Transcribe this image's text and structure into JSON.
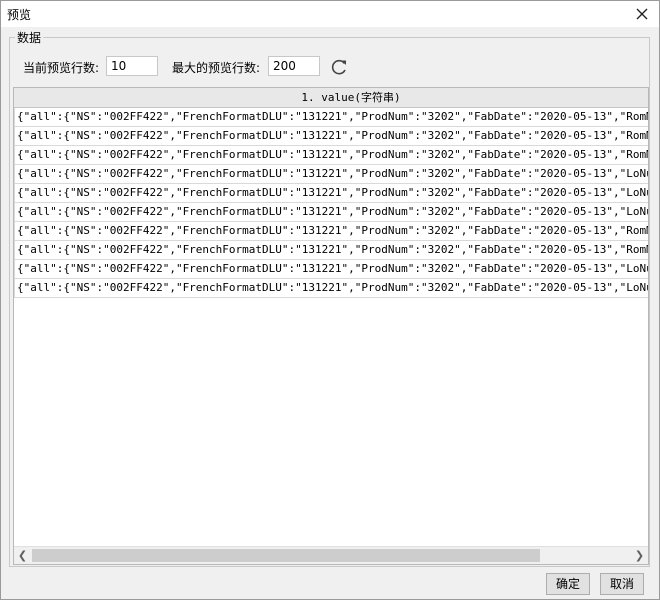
{
  "window": {
    "title": "预览"
  },
  "group": {
    "label": "数据"
  },
  "controls": {
    "current_rows_label": "当前预览行数:",
    "current_rows_value": "10",
    "max_rows_label": "最大的预览行数:",
    "max_rows_value": "200"
  },
  "grid": {
    "header": "1. value(字符串)",
    "rows": [
      "{\"all\":{\"NS\":\"002FF422\",\"FrenchFormatDLU\":\"131221\",\"ProdNum\":\"3202\",\"FabDate\":\"2020-05-13\",\"RomMask\":\"W2\",",
      "{\"all\":{\"NS\":\"002FF422\",\"FrenchFormatDLU\":\"131221\",\"ProdNum\":\"3202\",\"FabDate\":\"2020-05-13\",\"RomMask\":\"W2\",",
      "{\"all\":{\"NS\":\"002FF422\",\"FrenchFormatDLU\":\"131221\",\"ProdNum\":\"3202\",\"FabDate\":\"2020-05-13\",\"RomMask\":\"W2\",",
      "{\"all\":{\"NS\":\"002FF422\",\"FrenchFormatDLU\":\"131221\",\"ProdNum\":\"3202\",\"FabDate\":\"2020-05-13\",\"LoNum\":\"\",\"Ron",
      "{\"all\":{\"NS\":\"002FF422\",\"FrenchFormatDLU\":\"131221\",\"ProdNum\":\"3202\",\"FabDate\":\"2020-05-13\",\"LoNum\":\"\",\"Ron",
      "{\"all\":{\"NS\":\"002FF422\",\"FrenchFormatDLU\":\"131221\",\"ProdNum\":\"3202\",\"FabDate\":\"2020-05-13\",\"LoNum\":\"\",\"Ron",
      "{\"all\":{\"NS\":\"002FF422\",\"FrenchFormatDLU\":\"131221\",\"ProdNum\":\"3202\",\"FabDate\":\"2020-05-13\",\"RomMask\":\"W2\",",
      "{\"all\":{\"NS\":\"002FF422\",\"FrenchFormatDLU\":\"131221\",\"ProdNum\":\"3202\",\"FabDate\":\"2020-05-13\",\"RomMask\":\"W2\",",
      "{\"all\":{\"NS\":\"002FF422\",\"FrenchFormatDLU\":\"131221\",\"ProdNum\":\"3202\",\"FabDate\":\"2020-05-13\",\"LoNum\":\"\",\"Ron",
      "{\"all\":{\"NS\":\"002FF422\",\"FrenchFormatDLU\":\"131221\",\"ProdNum\":\"3202\",\"FabDate\":\"2020-05-13\",\"LoNum\":\"\",\"Ron"
    ]
  },
  "footer": {
    "ok_label": "确定",
    "cancel_label": "取消"
  },
  "icons": {
    "close": "close-icon",
    "refresh": "refresh-icon",
    "scroll_left": "chevron-left-icon",
    "scroll_right": "chevron-right-icon"
  }
}
